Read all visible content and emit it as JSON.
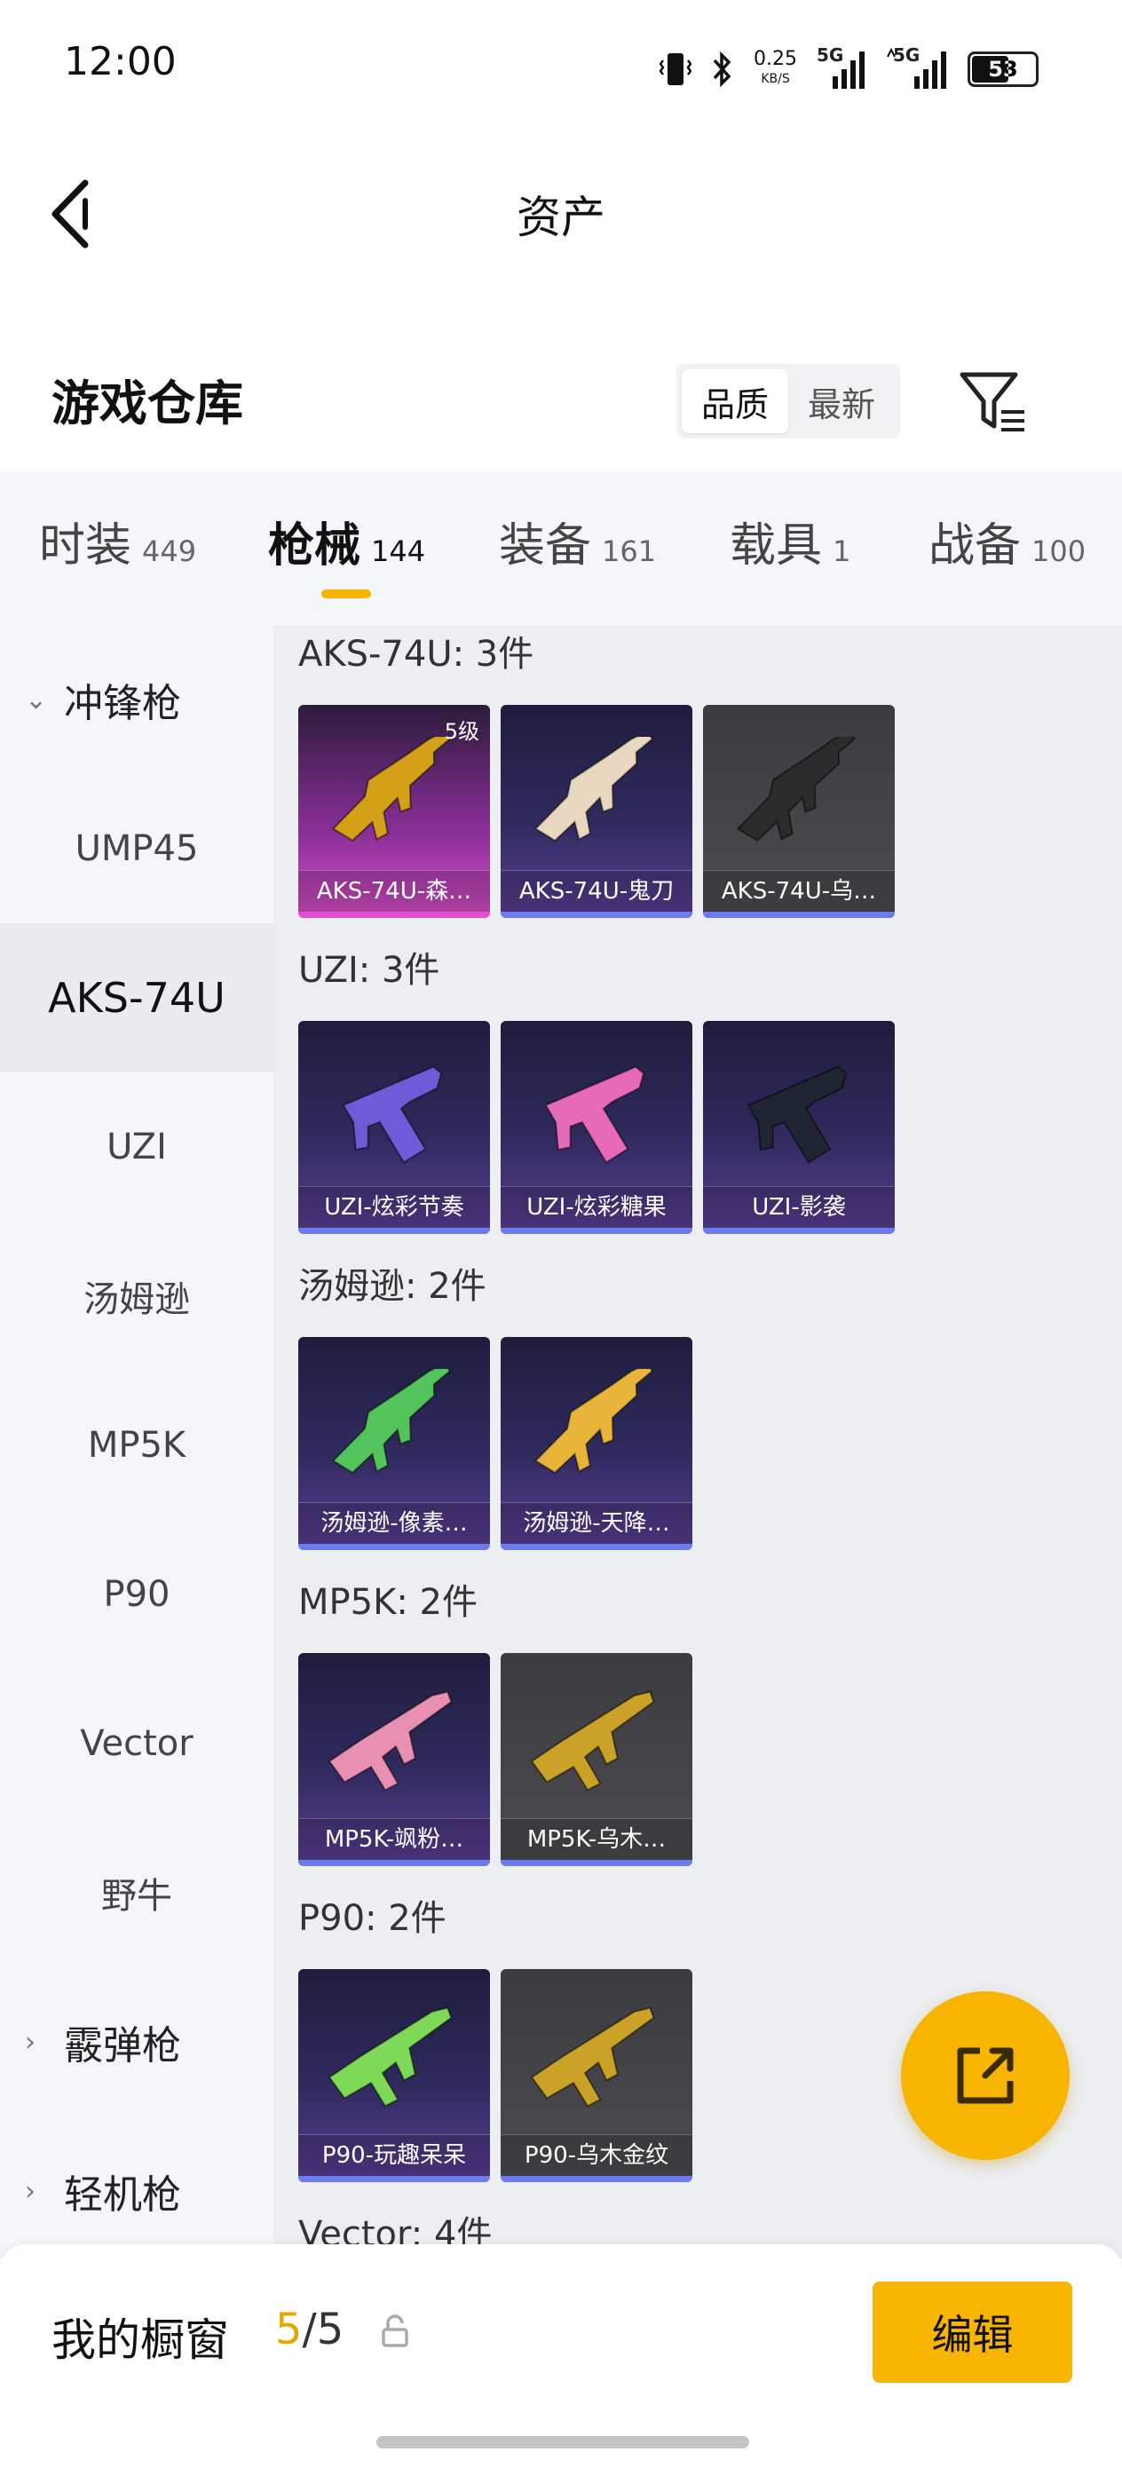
{
  "status_bar": {
    "time": "12:00",
    "speed": "0.25",
    "speed_unit": "KB/S",
    "net1": "5G",
    "net2": "5G",
    "battery": "53"
  },
  "header": {
    "title": "资产"
  },
  "warehouse": {
    "title": "游戏仓库",
    "sort_options": [
      "品质",
      "最新"
    ],
    "active_sort": "品质"
  },
  "categories": [
    {
      "label": "时装",
      "count": "449"
    },
    {
      "label": "枪械",
      "count": "144"
    },
    {
      "label": "装备",
      "count": "161"
    },
    {
      "label": "载具",
      "count": "1"
    },
    {
      "label": "战备",
      "count": "100"
    }
  ],
  "active_category": "枪械",
  "sidebar": {
    "groups": [
      {
        "label": "冲锋枪",
        "expanded": true
      },
      {
        "label": "霰弹枪",
        "expanded": false
      },
      {
        "label": "轻机枪",
        "expanded": false
      }
    ],
    "items": [
      "UMP45",
      "AKS-74U",
      "UZI",
      "汤姆逊",
      "MP5K",
      "P90",
      "Vector",
      "野牛"
    ],
    "active_item": "AKS-74U"
  },
  "sections": [
    {
      "title": "AKS-74U: 3件",
      "items": [
        {
          "name": "AKS-74U-森…",
          "level": "5级",
          "rarity": "pink",
          "accent": "#d4a017",
          "icon": "rifle-icon"
        },
        {
          "name": "AKS-74U-鬼刀",
          "rarity": "purple",
          "accent": "#e8d8c0",
          "icon": "rifle-icon"
        },
        {
          "name": "AKS-74U-乌…",
          "rarity": "grey",
          "accent": "#2b2b2b",
          "icon": "rifle-icon"
        }
      ]
    },
    {
      "title": "UZI: 3件",
      "items": [
        {
          "name": "UZI-炫彩节奏",
          "rarity": "purple",
          "accent": "#6f5bd8",
          "icon": "pistol-icon"
        },
        {
          "name": "UZI-炫彩糖果",
          "rarity": "purple",
          "accent": "#e66ab8",
          "icon": "pistol-icon"
        },
        {
          "name": "UZI-影袭",
          "rarity": "purple",
          "accent": "#1f2533",
          "icon": "pistol-icon"
        }
      ]
    },
    {
      "title": "汤姆逊: 2件",
      "items": [
        {
          "name": "汤姆逊-像素…",
          "rarity": "purple",
          "accent": "#53c45b",
          "icon": "rifle-icon"
        },
        {
          "name": "汤姆逊-天降…",
          "rarity": "purple",
          "accent": "#e8b53a",
          "icon": "rifle-icon"
        }
      ]
    },
    {
      "title": "MP5K: 2件",
      "items": [
        {
          "name": "MP5K-飒粉…",
          "rarity": "purple",
          "accent": "#e98fb2",
          "icon": "smg-icon"
        },
        {
          "name": "MP5K-乌木…",
          "rarity": "grey",
          "accent": "#c9a227",
          "icon": "smg-icon"
        }
      ]
    },
    {
      "title": "P90: 2件",
      "items": [
        {
          "name": "P90-玩趣呆呆",
          "rarity": "purple",
          "accent": "#7ed957",
          "icon": "smg-icon"
        },
        {
          "name": "P90-乌木金纹",
          "rarity": "grey",
          "accent": "#c9a227",
          "icon": "smg-icon"
        }
      ]
    },
    {
      "title": "Vector: 4件",
      "items": []
    }
  ],
  "bottom": {
    "window_label": "我的橱窗",
    "count_current": "5",
    "count_total": "/5",
    "edit_label": "编辑"
  }
}
